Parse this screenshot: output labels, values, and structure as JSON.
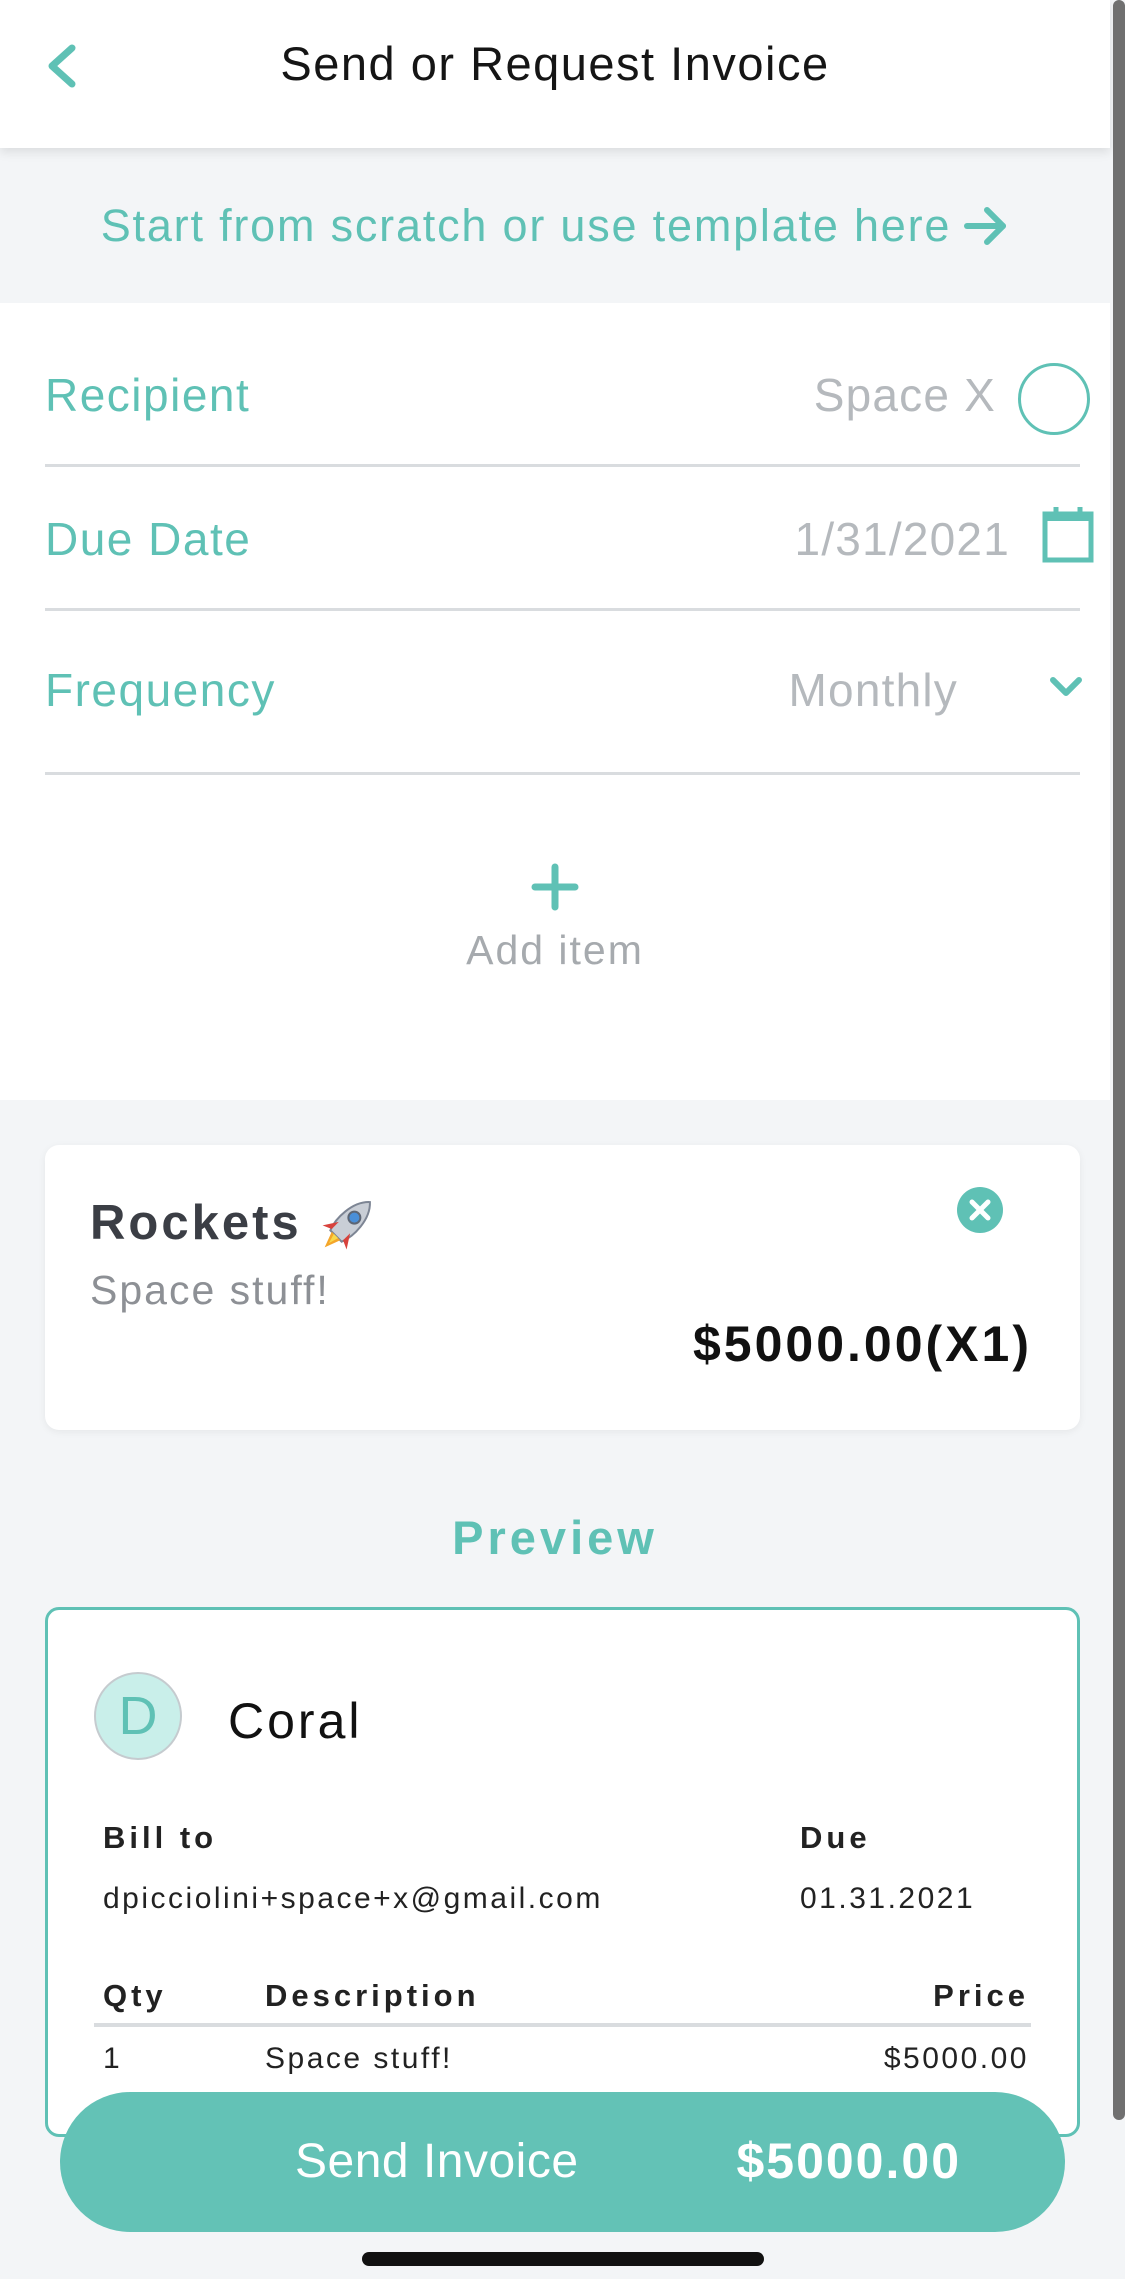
{
  "header": {
    "title": "Send or Request Invoice"
  },
  "template_link": {
    "label": "Start from scratch or use template here"
  },
  "form": {
    "recipient": {
      "label": "Recipient",
      "value": "Space X"
    },
    "due_date": {
      "label": "Due Date",
      "value": "1/31/2021"
    },
    "frequency": {
      "label": "Frequency",
      "value": "Monthly"
    },
    "add_item_label": "Add item"
  },
  "item": {
    "name": "Rockets",
    "description": "Space stuff!",
    "price": "$5000.00(X1)"
  },
  "preview": {
    "title": "Preview",
    "avatar_letter": "D",
    "company": "Coral",
    "bill_to_label": "Bill to",
    "bill_to_value": "dpicciolini+space+x@gmail.com",
    "due_label": "Due",
    "due_value": "01.31.2021",
    "table": {
      "headers": [
        "Qty",
        "Description",
        "Price"
      ],
      "rows": [
        [
          "1",
          "Space stuff!",
          "$5000.00"
        ]
      ]
    }
  },
  "send_button": {
    "label": "Send Invoice",
    "amount": "$5000.00"
  },
  "colors": {
    "accent": "#5fc1b5",
    "button": "#63c2b6",
    "background": "#f3f5f7"
  }
}
